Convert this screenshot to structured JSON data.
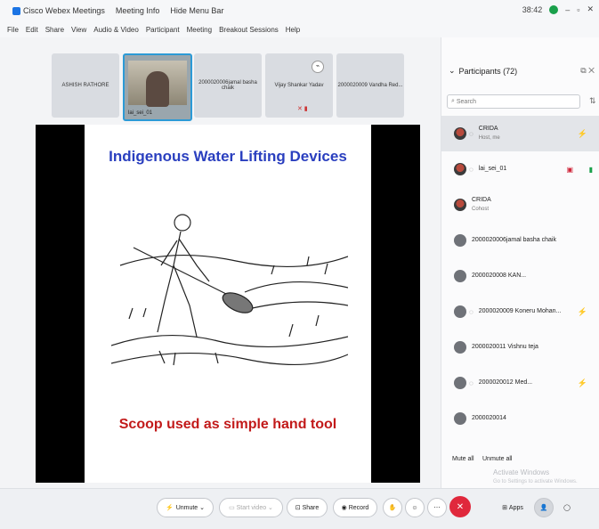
{
  "window": {
    "app_title": "Cisco Webex Meetings",
    "meeting_info": "Meeting Info",
    "hide_menu": "Hide Menu Bar",
    "time": "38:42"
  },
  "menu": [
    "File",
    "Edit",
    "Share",
    "View",
    "Audio & Video",
    "Participant",
    "Meeting",
    "Breakout Sessions",
    "Help"
  ],
  "video_strip": [
    {
      "label": "ASHISH RATHORE"
    },
    {
      "label": "lai_sei_01"
    },
    {
      "label": "2000020006jamal basha chaik"
    },
    {
      "label": "Vijay Shankar Yadav"
    },
    {
      "label": "2000020009 Vandha Red..."
    }
  ],
  "slide": {
    "title": "Indigenous Water Lifting Devices",
    "caption": "Scoop used as simple hand tool"
  },
  "participants": {
    "header": "Participants (72)",
    "search_placeholder": "Search",
    "list": [
      {
        "name": "CRIDA",
        "role": "Host, me"
      },
      {
        "name": "lai_sei_01",
        "role": ""
      },
      {
        "name": "CRIDA",
        "role": "Cohost"
      },
      {
        "name": "2000020006jamal basha chaik",
        "role": ""
      },
      {
        "name": "2000020008 KAN...",
        "role": ""
      },
      {
        "name": "2000020009 Koneru Mohan...",
        "role": ""
      },
      {
        "name": "2000020011 Vishnu teja",
        "role": ""
      },
      {
        "name": "2000020012 Med...",
        "role": ""
      },
      {
        "name": "2000020014",
        "role": ""
      }
    ],
    "mute_all": "Mute all",
    "unmute_all": "Unmute all",
    "watermark": "Activate Windows",
    "watermark_sub": "Go to Settings to activate Windows."
  },
  "controls": {
    "unmute": "Unmute",
    "start_video": "Start video",
    "share": "Share",
    "record": "Record",
    "apps": "Apps"
  }
}
